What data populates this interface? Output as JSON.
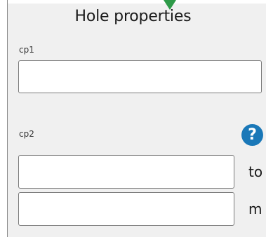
{
  "panel": {
    "title": "Hole properties"
  },
  "fields": {
    "cp1_label": "cp1",
    "cp1_value": "",
    "cp2_label": "cp2",
    "cp2_value_a": "",
    "cp2_value_b": ""
  },
  "help": {
    "glyph": "?"
  },
  "side_labels": {
    "first": "to",
    "second": "m"
  },
  "colors": {
    "marker": "#2e9a48",
    "help_badge": "#1a78b8"
  },
  "icons": {
    "marker": "triangle-down-icon",
    "help": "help-icon"
  }
}
